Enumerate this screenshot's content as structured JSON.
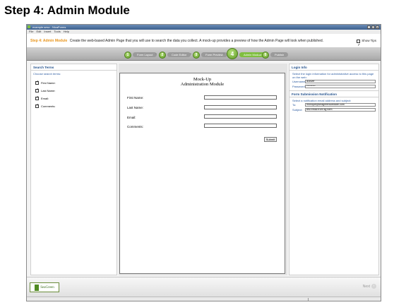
{
  "page_heading": "Step 4: Admin Module",
  "window": {
    "title": "example.sesx - NicaForms",
    "menu": [
      "File",
      "Edit",
      "Insert",
      "Tools",
      "Help"
    ],
    "controls": [
      "_",
      "□",
      "x"
    ]
  },
  "stepbar": {
    "title": "Step 4: Admin Module",
    "description": "Create the web-based Admin Page that you will use to search the data you collect.  A mock-up provides a preview of how the Admin Page will look when published.",
    "show_tips_label": "Show Tips",
    "show_tips_checked": true
  },
  "wizard": {
    "steps": [
      {
        "num": "1",
        "label": "Form Layout"
      },
      {
        "num": "2",
        "label": "Code Editor"
      },
      {
        "num": "3",
        "label": "Form Preview"
      },
      {
        "num": "4",
        "label": "Admin Module"
      },
      {
        "num": "5",
        "label": "Publish"
      }
    ],
    "active_index": 3
  },
  "search_terms": {
    "title": "Search Terms",
    "subtitle": "Choose search terms:",
    "items": [
      {
        "label": "First Name:",
        "checked": true
      },
      {
        "label": "Last Name:",
        "checked": true
      },
      {
        "label": "Email:",
        "checked": true
      },
      {
        "label": "Comments:",
        "checked": true
      }
    ]
  },
  "mockup": {
    "title_line1": "Mock-Up",
    "title_line2": "Administration Module",
    "fields": [
      "First Name:",
      "Last Name:",
      "Email:",
      "Comments:"
    ],
    "submit_label": "Submit"
  },
  "login_info": {
    "title": "Login Info",
    "description": "Select the login information for administrative access to this page on the web:",
    "username_label": "Username:",
    "username_value": "lkdover",
    "password_label": "Password:",
    "password_value": "*********"
  },
  "notification": {
    "title": "Form Submission Notification",
    "description": "Select a notification email address and subject:",
    "to_label": "To:",
    "to_value": "monique@seagreensoftware.com",
    "subject_label": "Subject:",
    "subject_value": "test email from sg form"
  },
  "footer": {
    "logo_text": "SeaGreen",
    "next_label": "Next"
  }
}
